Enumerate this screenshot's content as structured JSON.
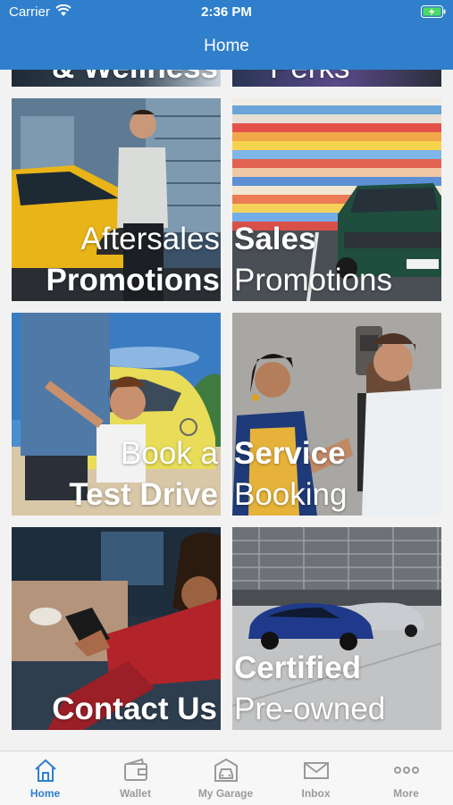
{
  "status_bar": {
    "carrier": "Carrier",
    "time": "2:36 PM"
  },
  "nav": {
    "title": "Home"
  },
  "partial_tiles": {
    "left": "& Wellness",
    "right": "Perks"
  },
  "tiles": [
    {
      "line1": "Aftersales",
      "line2": "Promotions"
    },
    {
      "line1": "Sales",
      "line2": "Promotions"
    },
    {
      "line1": "Book a",
      "line2": "Test Drive"
    },
    {
      "line1": "Service",
      "line2": "Booking"
    },
    {
      "line1": "Contact Us"
    },
    {
      "line1": "Certified",
      "line2": "Pre-owned"
    }
  ],
  "tab_bar": {
    "active_color": "#2f7fcc",
    "tabs": [
      {
        "label": "Home",
        "icon": "home-icon",
        "active": true
      },
      {
        "label": "Wallet",
        "icon": "wallet-icon",
        "active": false
      },
      {
        "label": "My Garage",
        "icon": "garage-icon",
        "active": false
      },
      {
        "label": "Inbox",
        "icon": "inbox-icon",
        "active": false
      },
      {
        "label": "More",
        "icon": "more-icon",
        "active": false
      }
    ]
  }
}
